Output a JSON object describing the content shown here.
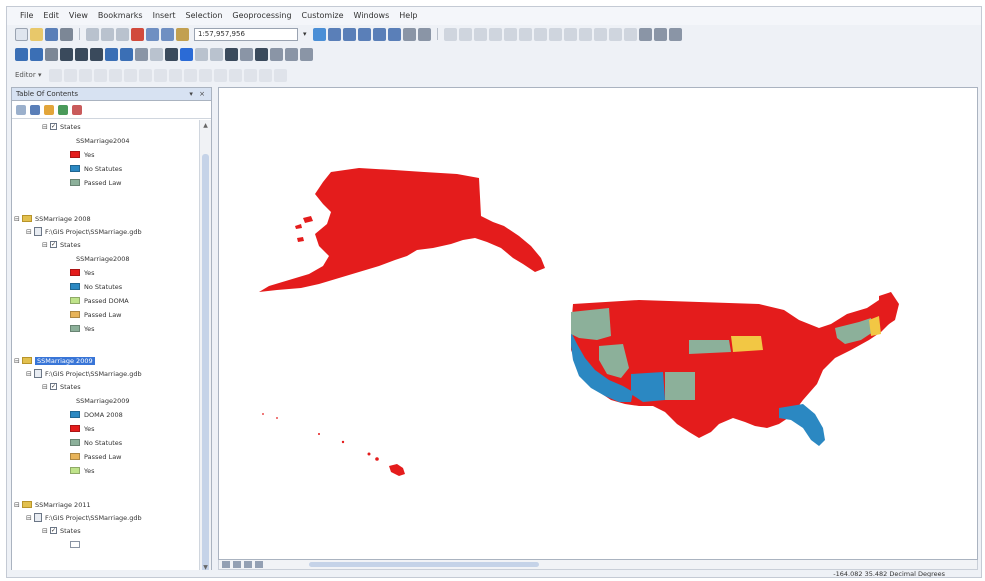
{
  "menu": [
    "File",
    "Edit",
    "View",
    "Bookmarks",
    "Insert",
    "Selection",
    "Geoprocessing",
    "Customize",
    "Windows",
    "Help"
  ],
  "toolbar": {
    "scale": "1:57,957,956",
    "editor_label": "Editor ▾"
  },
  "toc": {
    "title": "Table Of Contents",
    "controls": "▾ ×",
    "groups": [
      {
        "name": "",
        "layer": "States",
        "field": "SSMarriage2004",
        "classes": [
          {
            "label": "Yes",
            "color": "#e41c1c"
          },
          {
            "label": "No Statutes",
            "color": "#2b88c2"
          },
          {
            "label": "Passed Law",
            "color": "#8cb09a"
          }
        ]
      },
      {
        "name": "SSMarriage 2008",
        "path": "F:\\GIS Project\\SSMarriage.gdb",
        "layer": "States",
        "field": "SSMarriage2008",
        "classes": [
          {
            "label": "Yes",
            "color": "#e41c1c"
          },
          {
            "label": "No Statutes",
            "color": "#2b88c2"
          },
          {
            "label": "Passed DOMA",
            "color": "#bfe38a"
          },
          {
            "label": "Passed Law",
            "color": "#e8b45a"
          },
          {
            "label": "Yes",
            "color": "#8cb09a"
          }
        ]
      },
      {
        "name": "SSMarriage 2009",
        "path": "F:\\GIS Project\\SSMarriage.gdb",
        "layer": "States",
        "field": "SSMarriage2009",
        "classes": [
          {
            "label": "DOMA 2008",
            "color": "#2b88c2"
          },
          {
            "label": "Yes",
            "color": "#e41c1c"
          },
          {
            "label": "No Statutes",
            "color": "#8cb09a"
          },
          {
            "label": "Passed Law",
            "color": "#e8b45a"
          },
          {
            "label": "Yes",
            "color": "#bfe38a"
          }
        ]
      },
      {
        "name": "SSMarriage 2011",
        "path": "F:\\GIS Project\\SSMarriage.gdb",
        "layer": "States",
        "classes": [
          {
            "label": "",
            "color": "#ffffff"
          }
        ]
      }
    ]
  },
  "status": {
    "coords": "-164.082  35.482 Decimal Degrees"
  },
  "colors": {
    "red": "#e41c1c",
    "blue": "#2b88c2",
    "sage": "#8cb09a",
    "yellow": "#f2c744",
    "lightgreen": "#bfe38a"
  }
}
